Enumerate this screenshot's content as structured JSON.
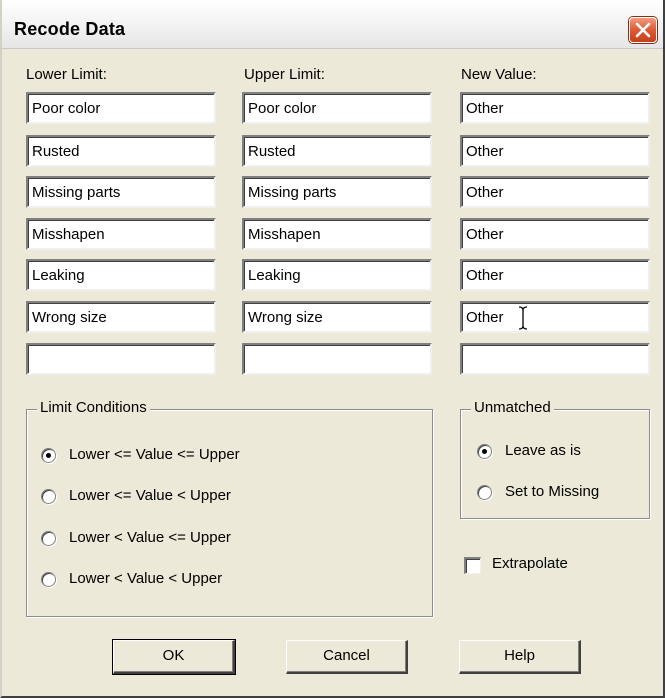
{
  "window": {
    "title": "Recode Data",
    "accent_close_color": "#d9532e"
  },
  "columns": {
    "lower_label": "Lower Limit:",
    "upper_label": "Upper Limit:",
    "new_label": "New Value:"
  },
  "rows": [
    {
      "lower": "Poor color",
      "upper": "Poor color",
      "new": "Other"
    },
    {
      "lower": "Rusted",
      "upper": "Rusted",
      "new": "Other"
    },
    {
      "lower": "Missing parts",
      "upper": "Missing parts",
      "new": "Other"
    },
    {
      "lower": "Misshapen",
      "upper": "Misshapen",
      "new": "Other"
    },
    {
      "lower": "Leaking",
      "upper": "Leaking",
      "new": "Other"
    },
    {
      "lower": "Wrong size",
      "upper": "Wrong size",
      "new": "Other"
    },
    {
      "lower": "",
      "upper": "",
      "new": ""
    }
  ],
  "limit_conditions": {
    "title": "Limit Conditions",
    "options": [
      {
        "label": "Lower <= Value <= Upper",
        "checked": true
      },
      {
        "label": "Lower <= Value < Upper",
        "checked": false
      },
      {
        "label": "Lower < Value <= Upper",
        "checked": false
      },
      {
        "label": "Lower < Value < Upper",
        "checked": false
      }
    ]
  },
  "unmatched": {
    "title": "Unmatched",
    "options": [
      {
        "label": "Leave as is",
        "checked": true
      },
      {
        "label": "Set to Missing",
        "checked": false
      }
    ]
  },
  "extrapolate": {
    "label": "Extrapolate",
    "checked": false
  },
  "buttons": {
    "ok": "OK",
    "cancel": "Cancel",
    "help": "Help"
  },
  "icons": {
    "close": "close-icon",
    "cursor": "text-cursor-icon"
  }
}
